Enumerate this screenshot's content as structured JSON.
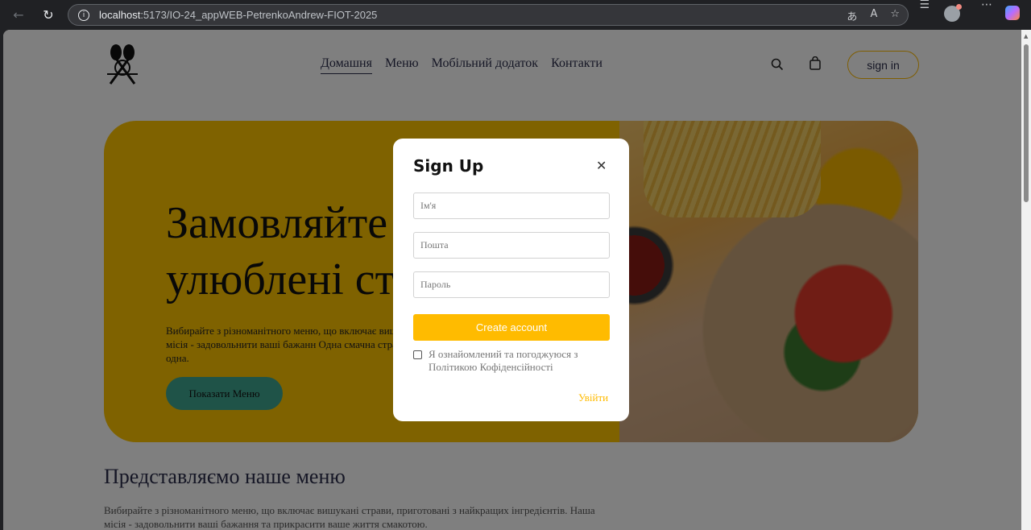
{
  "browser": {
    "url_host": "localhost",
    "url_path": ":5173/IO-24_appWEB-PetrenkoAndrew-FIOT-2025"
  },
  "header": {
    "nav": [
      "Домашня",
      "Меню",
      "Мобільний додаток",
      "Контакти"
    ],
    "signin_label": "sign in"
  },
  "hero": {
    "title_line1": "Замовляйте",
    "title_line2": "улюблені ст",
    "text": "Вибирайте з різноманітного меню, що включає вишу інгредієнтів. Наша місія - задовольнити ваші бажанн Одна смачна страва за раз, а може й не одна.",
    "button_label": "Показати Меню"
  },
  "menu_section": {
    "title": "Представляємо наше меню",
    "text": "Вибирайте з різноманітного меню, що включає вишукані страви, приготовані з найкращих інгредієнтів. Наша місія - задовольнити ваші бажання та прикрасити ваше життя смакотою."
  },
  "modal": {
    "title": "Sign Up",
    "name_placeholder": "Ім'я",
    "email_placeholder": "Пошта",
    "password_placeholder": "Пароль",
    "create_label": "Create account",
    "agree_text": "Я ознайомлений та погоджуюся з Політикою Кофіденсійності",
    "login_label": "Увійти"
  },
  "colors": {
    "accent": "#ffbb00",
    "hero_bg": "#ffc400",
    "hero_button": "#3fa791"
  }
}
